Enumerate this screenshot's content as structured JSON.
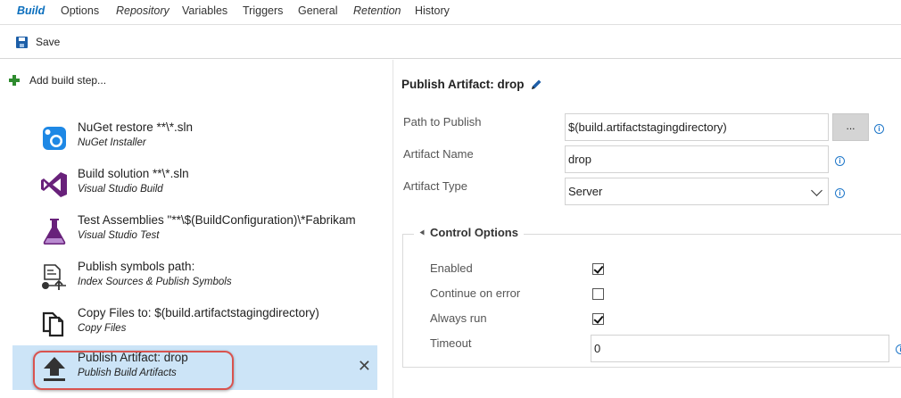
{
  "tabs": [
    {
      "label": "Build"
    },
    {
      "label": "Options"
    },
    {
      "label": "Repository"
    },
    {
      "label": "Variables"
    },
    {
      "label": "Triggers"
    },
    {
      "label": "General"
    },
    {
      "label": "Retention"
    },
    {
      "label": "History"
    }
  ],
  "toolbar": {
    "save_label": "Save"
  },
  "left": {
    "add_label": "Add build step...",
    "steps": [
      {
        "title": "NuGet restore **\\*.sln",
        "subtitle": "NuGet Installer",
        "icon": "nuget-icon"
      },
      {
        "title": "Build solution **\\*.sln",
        "subtitle": "Visual Studio Build",
        "icon": "visual-studio-icon"
      },
      {
        "title": "Test Assemblies \"**\\$(BuildConfiguration)\\*Fabrikam",
        "subtitle": "Visual Studio Test",
        "icon": "flask-icon"
      },
      {
        "title": "Publish symbols path:",
        "subtitle": "Index Sources & Publish Symbols",
        "icon": "symbols-icon"
      },
      {
        "title": "Copy Files to: $(build.artifactstagingdirectory)",
        "subtitle": "Copy Files",
        "icon": "copy-files-icon"
      },
      {
        "title": "Publish Artifact: drop",
        "subtitle": "Publish Build Artifacts",
        "icon": "upload-icon"
      }
    ],
    "remove_glyph": "✕"
  },
  "right": {
    "title": "Publish Artifact: drop",
    "fields": {
      "path_label": "Path to Publish",
      "path_value": "$(build.artifactstagingdirectory)",
      "browse_label": "...",
      "name_label": "Artifact Name",
      "name_value": "drop",
      "type_label": "Artifact Type",
      "type_value": "Server"
    },
    "control": {
      "header": "Control Options",
      "enabled_label": "Enabled",
      "enabled": true,
      "continue_label": "Continue on error",
      "continue": false,
      "always_label": "Always run",
      "always": true,
      "timeout_label": "Timeout",
      "timeout_value": "0"
    },
    "info_glyph": "i"
  },
  "colors": {
    "accent": "#0a6ebd",
    "selection": "#cce4f7",
    "highlight": "#d9534f",
    "add": "#2e8b2e"
  }
}
